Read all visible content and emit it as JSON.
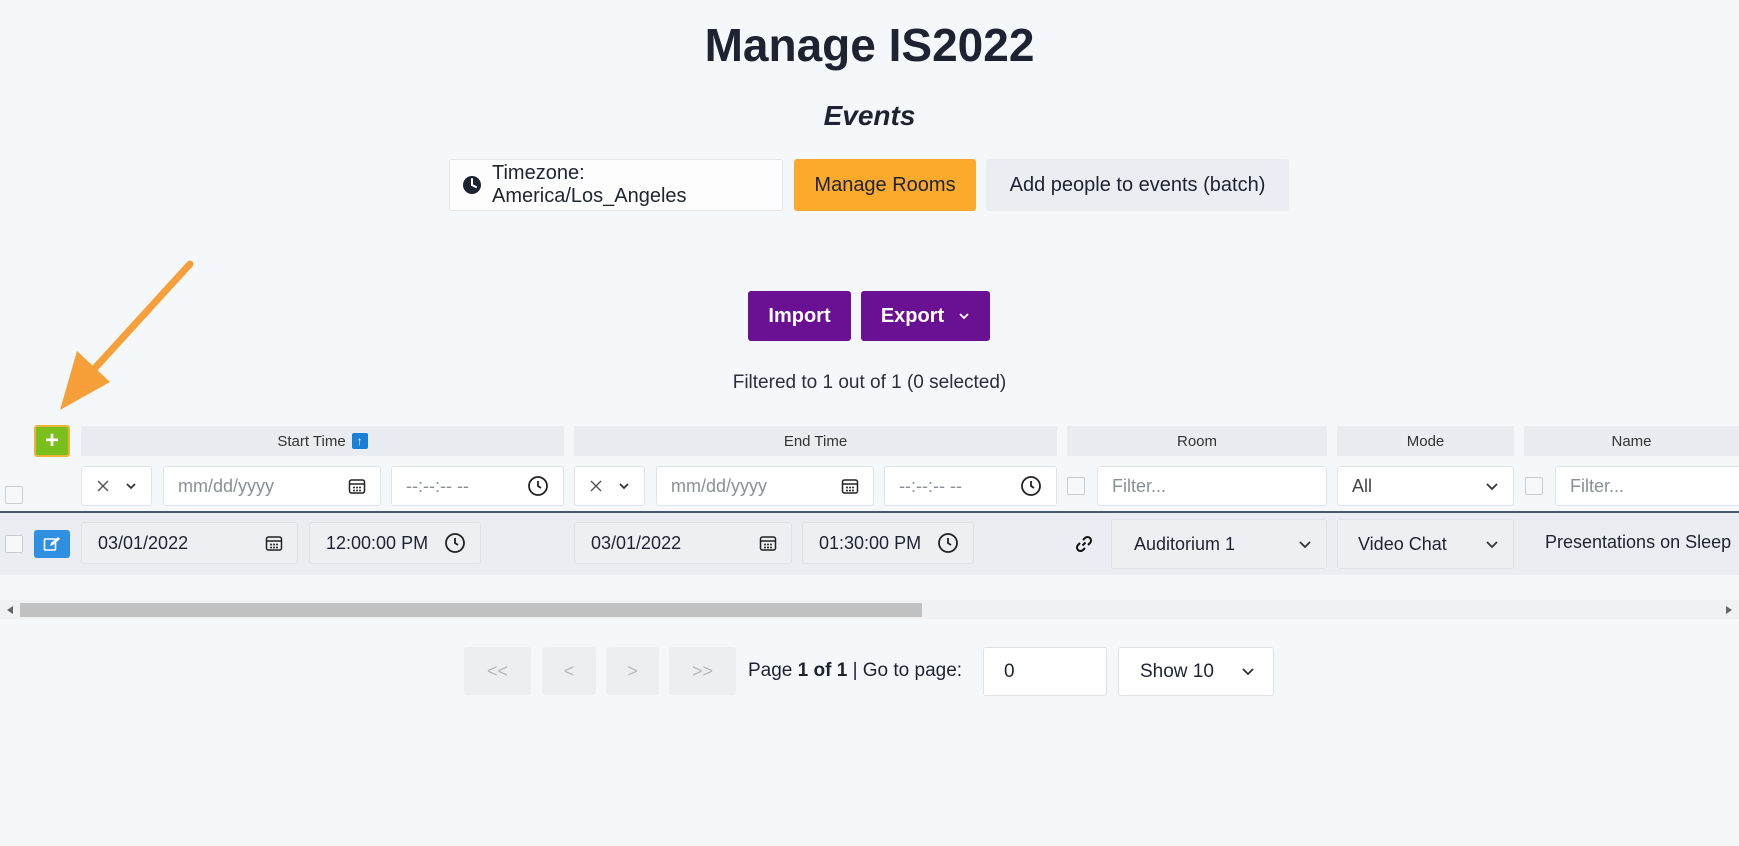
{
  "page": {
    "title": "Manage IS2022",
    "subtitle": "Events"
  },
  "toolbar": {
    "timezone_label": "Timezone: America/Los_Angeles",
    "manage_rooms_label": "Manage Rooms",
    "add_people_label": "Add people to events (batch)",
    "import_label": "Import",
    "export_label": "Export"
  },
  "status": {
    "filtered_text": "Filtered to 1 out of 1 (0 selected)"
  },
  "table": {
    "add_label": "+",
    "columns": {
      "start_time": "Start Time",
      "end_time": "End Time",
      "room": "Room",
      "mode": "Mode",
      "name": "Name"
    },
    "sort_indicator": "↑",
    "filters": {
      "date_placeholder": "mm/dd/yyyy",
      "time_placeholder": "--:--:-- --",
      "room_placeholder": "Filter...",
      "mode_value": "All",
      "name_placeholder": "Filter..."
    },
    "rows": [
      {
        "start_date": "03/01/2022",
        "start_time": "12:00:00 PM",
        "end_date": "03/01/2022",
        "end_time": "01:30:00 PM",
        "room": "Auditorium 1",
        "mode": "Video Chat",
        "name": "Presentations on Sleep"
      }
    ]
  },
  "pagination": {
    "first_label": "<<",
    "prev_label": "<",
    "next_label": ">",
    "last_label": ">>",
    "page_word": "Page",
    "page_of": "1 of 1",
    "goto_label": "| Go to page:",
    "goto_value": "0",
    "show_value": "Show 10"
  },
  "colors": {
    "accent_purple": "#6a1193",
    "accent_orange": "#fcaa2c",
    "add_green": "#7bbf1c",
    "edit_blue": "#2f8fe0",
    "annotation_arrow": "#f7a03a"
  }
}
